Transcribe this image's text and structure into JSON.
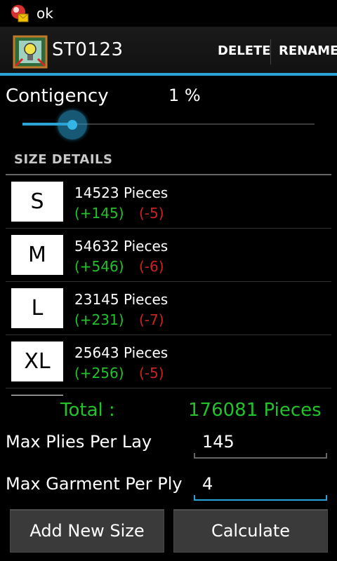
{
  "status_bar": {
    "title": "ok"
  },
  "action_bar": {
    "title": "ST0123",
    "delete_label": "DELETE",
    "rename_label": "RENAME",
    "accent_color": "#2aa3d6"
  },
  "contingency": {
    "label": "Contigency",
    "value": "1 %",
    "slider_fraction": 0.17
  },
  "size_section": {
    "header": "SIZE DETAILS",
    "items": [
      {
        "size": "S",
        "pieces": "14523 Pieces",
        "plus": "(+145)",
        "minus": "(-5)"
      },
      {
        "size": "M",
        "pieces": "54632 Pieces",
        "plus": "(+546)",
        "minus": "(-6)"
      },
      {
        "size": "L",
        "pieces": "23145 Pieces",
        "plus": "(+231)",
        "minus": "(-7)"
      },
      {
        "size": "XL",
        "pieces": "25643 Pieces",
        "plus": "(+256)",
        "minus": "(-5)"
      }
    ]
  },
  "total": {
    "label": "Total :",
    "value": "176081 Pieces",
    "color": "#22c22a"
  },
  "fields": {
    "max_plies": {
      "label": "Max Plies Per Lay",
      "value": "145"
    },
    "max_garment": {
      "label": "Max Garment Per Ply",
      "value": "4"
    }
  },
  "buttons": {
    "add_new_size": "Add New Size",
    "calculate": "Calculate"
  }
}
